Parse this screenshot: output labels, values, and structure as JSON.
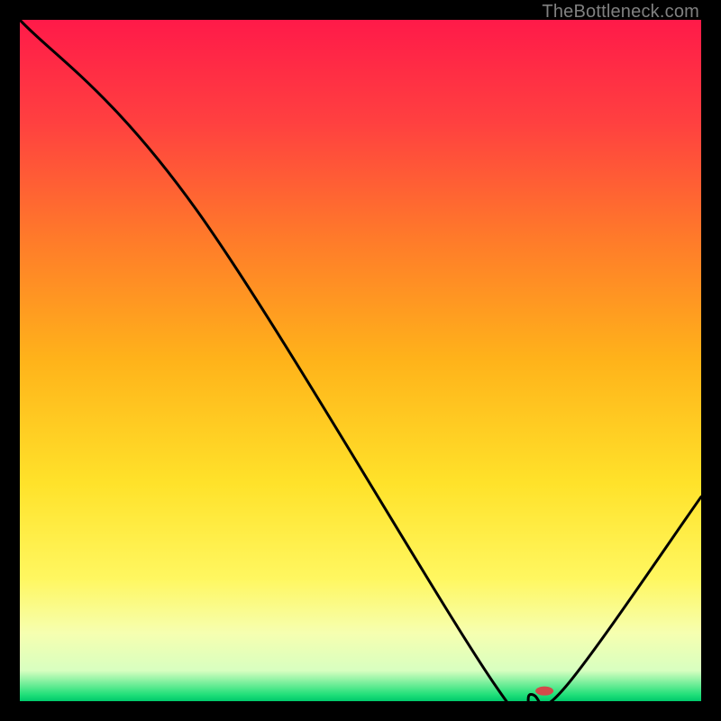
{
  "watermark": "TheBottleneck.com",
  "chart_data": {
    "type": "line",
    "title": "",
    "xlabel": "",
    "ylabel": "",
    "xlim": [
      0,
      100
    ],
    "ylim": [
      0,
      100
    ],
    "grid": false,
    "legend": false,
    "series": [
      {
        "name": "curve",
        "x": [
          0,
          26,
          70,
          75,
          80,
          100
        ],
        "y": [
          100,
          72,
          2,
          1,
          2,
          30
        ]
      }
    ],
    "marker": {
      "x": 77,
      "y": 1.5,
      "color": "#d24a4a",
      "rx": 10,
      "ry": 5
    },
    "background_gradient": {
      "stops": [
        {
          "pos": 0.0,
          "color": "#ff1a49"
        },
        {
          "pos": 0.15,
          "color": "#ff4040"
        },
        {
          "pos": 0.32,
          "color": "#ff7a2a"
        },
        {
          "pos": 0.5,
          "color": "#ffb31a"
        },
        {
          "pos": 0.68,
          "color": "#ffe22a"
        },
        {
          "pos": 0.82,
          "color": "#fff760"
        },
        {
          "pos": 0.9,
          "color": "#f6ffb0"
        },
        {
          "pos": 0.955,
          "color": "#d8ffc0"
        },
        {
          "pos": 0.99,
          "color": "#22e07a"
        },
        {
          "pos": 1.0,
          "color": "#00c96b"
        }
      ]
    }
  }
}
